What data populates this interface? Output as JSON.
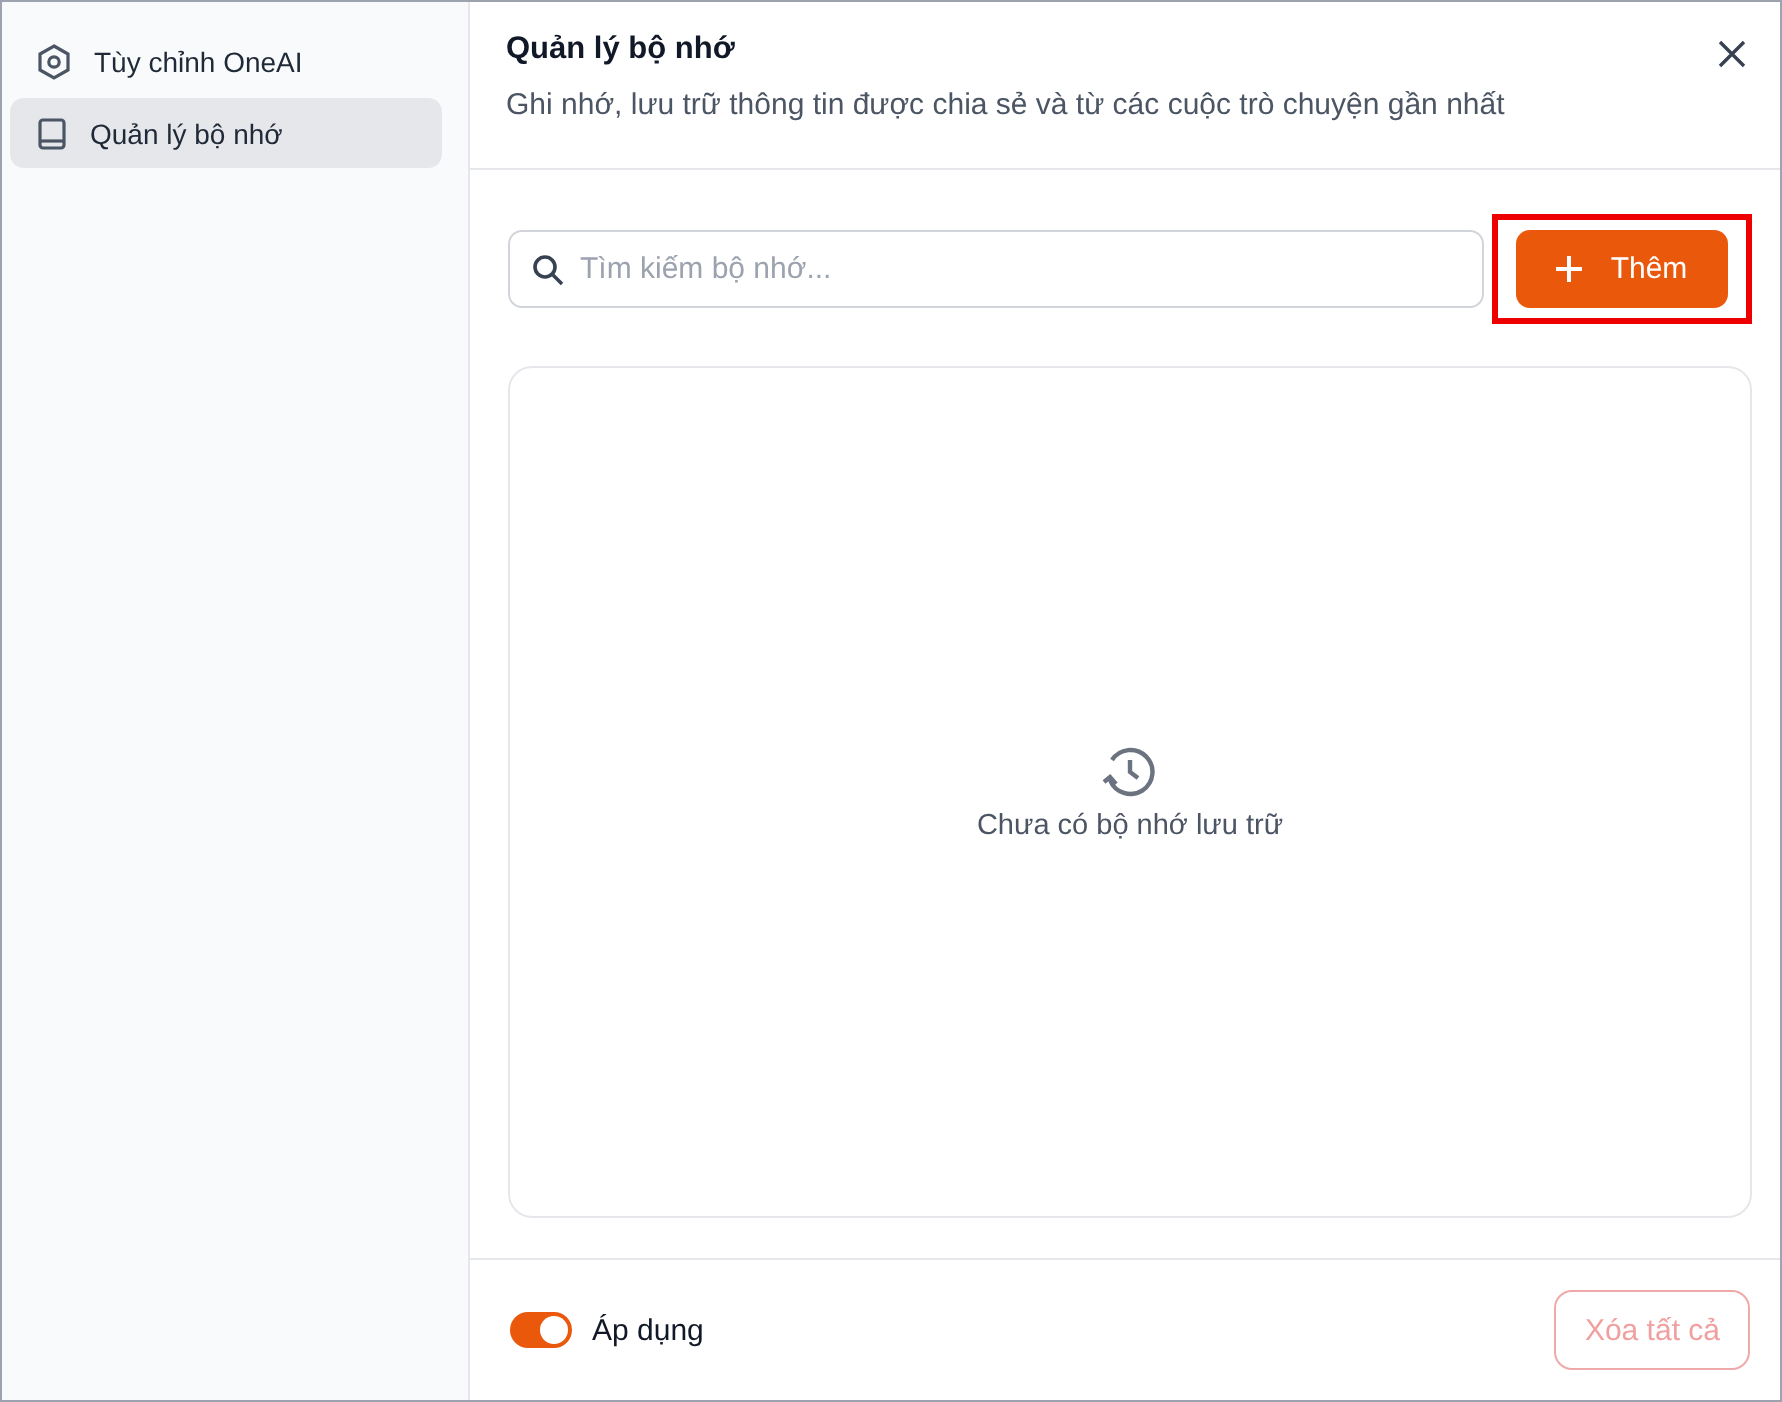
{
  "sidebar": {
    "items": [
      {
        "kind": "settings",
        "label": "Tùy chỉnh OneAI",
        "selected": false
      },
      {
        "kind": "book",
        "label": "Quản lý bộ nhớ",
        "selected": true
      }
    ]
  },
  "header": {
    "title": "Quản lý bộ nhớ",
    "subtitle": "Ghi nhớ, lưu trữ thông tin được chia sẻ và từ các cuộc trò chuyện gần nhất"
  },
  "search": {
    "placeholder": "Tìm kiếm bộ nhớ..."
  },
  "add_button": {
    "label": "Thêm",
    "highlighted": true
  },
  "empty_state": {
    "text": "Chưa có bộ nhớ lưu trữ"
  },
  "footer": {
    "toggle": {
      "label": "Áp dụng",
      "on": true
    },
    "clear_button": {
      "label": "Xóa tất cả",
      "disabled": true
    }
  }
}
